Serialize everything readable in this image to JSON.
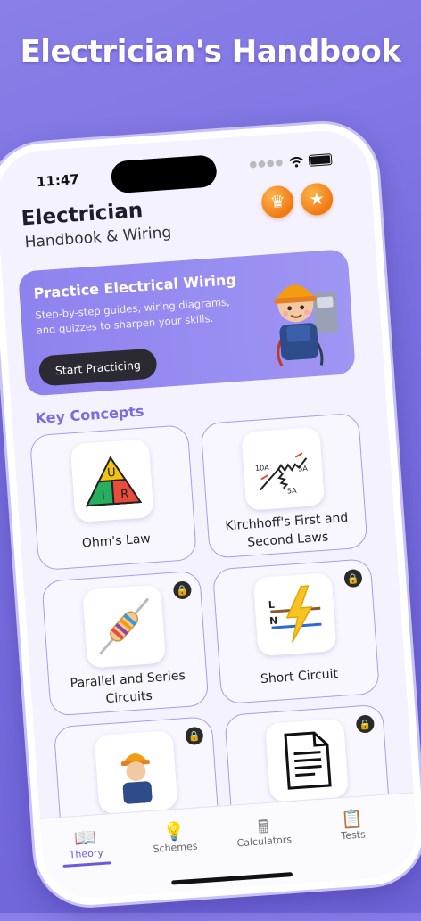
{
  "headline": "Electrician's Handbook",
  "status": {
    "time": "11:47"
  },
  "app": {
    "title": "Electrician",
    "subtitle": "Handbook & Wiring"
  },
  "banner": {
    "title": "Practice Electrical Wiring",
    "description": "Step-by-step guides, wiring diagrams, and quizzes to sharpen your skills.",
    "button": "Start Practicing"
  },
  "section_title": "Key Concepts",
  "cards": [
    {
      "label": "Ohm's Law",
      "icon": "ohms-triangle-icon",
      "locked": false,
      "tri": {
        "top": "U",
        "left": "I",
        "right": "R"
      }
    },
    {
      "label": "Kirchhoff's First and Second Laws",
      "icon": "kirchhoff-node-icon",
      "locked": false,
      "tags": [
        "10A",
        "5A",
        "5A"
      ]
    },
    {
      "label": "Parallel and Series Circuits",
      "icon": "resistor-icon",
      "locked": true
    },
    {
      "label": "Short Circuit",
      "icon": "lightning-icon",
      "locked": true,
      "tags": [
        "L",
        "N"
      ]
    },
    {
      "label": "",
      "icon": "electrician-icon",
      "locked": true
    },
    {
      "label": "",
      "icon": "document-icon",
      "locked": true
    }
  ],
  "tabs": [
    {
      "label": "Theory",
      "icon": "book-icon",
      "active": true
    },
    {
      "label": "Schemes",
      "icon": "bulb-icon",
      "active": false
    },
    {
      "label": "Calculators",
      "icon": "calculator-icon",
      "active": false
    },
    {
      "label": "Tests",
      "icon": "clipboard-icon",
      "active": false
    }
  ],
  "colors": {
    "accent": "#6b5bd9",
    "banner": "#8e82ee",
    "badge": "#f07a14"
  }
}
